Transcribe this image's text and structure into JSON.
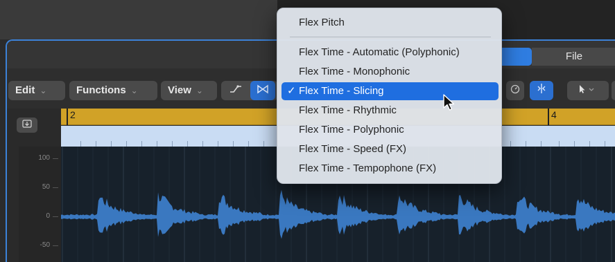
{
  "toolbar": {
    "edit_label": "Edit",
    "functions_label": "Functions",
    "view_label": "View",
    "chevron": "⌄"
  },
  "tabs": {
    "file_label": "File"
  },
  "ruler": {
    "bar_2": "2",
    "bar_4": "4"
  },
  "amplitude_scale": [
    "100",
    "50",
    "0",
    "-50"
  ],
  "flex_menu": {
    "header": "Flex Pitch",
    "items": [
      {
        "label": "Flex Time - Automatic (Polyphonic)",
        "selected": false
      },
      {
        "label": "Flex Time - Monophonic",
        "selected": false
      },
      {
        "label": "Flex Time - Slicing",
        "selected": true
      },
      {
        "label": "Flex Time - Rhythmic",
        "selected": false
      },
      {
        "label": "Flex Time - Polyphonic",
        "selected": false
      },
      {
        "label": "Flex Time - Speed (FX)",
        "selected": false
      },
      {
        "label": "Flex Time - Tempophone (FX)",
        "selected": false
      }
    ],
    "check_mark": "✓"
  },
  "icons": {
    "catch": "catch-playhead-icon",
    "automation": "automation-curve-icon",
    "flex": "flex-mode-icon",
    "tuner": "tuner-icon",
    "pointer": "pointer-tool-icon"
  },
  "colors": {
    "accent": "#2f7de1",
    "ruler": "#d1a227",
    "waveform": "#3a78c0",
    "selection": "#1f6ee0"
  }
}
